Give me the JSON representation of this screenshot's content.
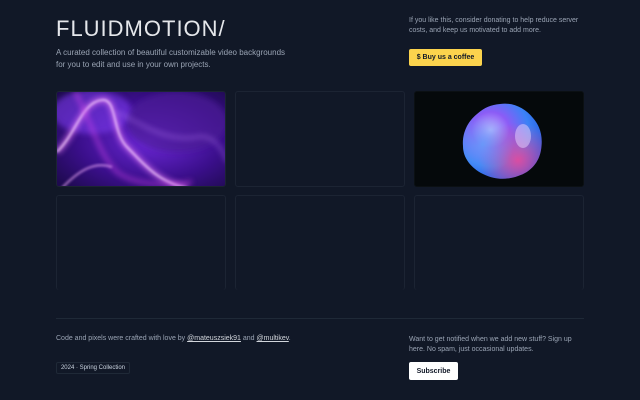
{
  "header": {
    "logo": "FLUIDMOTION/",
    "tagline": "A curated collection of beautiful customizable video backgrounds for you to edit and use in your own projects."
  },
  "donate": {
    "text": "If you like this, consider donating to help reduce server costs, and keep us motivated to add more.",
    "button_label": "$ Buy us a coffee"
  },
  "gallery": {
    "tiles": [
      {
        "preview": "purple-plasma-waves"
      },
      {
        "preview": "blank"
      },
      {
        "preview": "iridescent-blob"
      },
      {
        "preview": "blank"
      },
      {
        "preview": "blank"
      },
      {
        "preview": "blank"
      }
    ]
  },
  "footer": {
    "credit_prefix": "Code and pixels were crafted with love by",
    "author1": "@mateuszsiek91",
    "credit_and": "and",
    "author2": "@multikev",
    "credit_suffix": ".",
    "collection_badge": "2024 · Spring Collection",
    "notify_text": "Want to get notified when we add new stuff? Sign up here. No spam, just occasional updates.",
    "subscribe_label": "Subscribe"
  },
  "colors": {
    "background": "#111827",
    "accent_yellow": "#fcd34d",
    "button_white": "#ffffff"
  }
}
